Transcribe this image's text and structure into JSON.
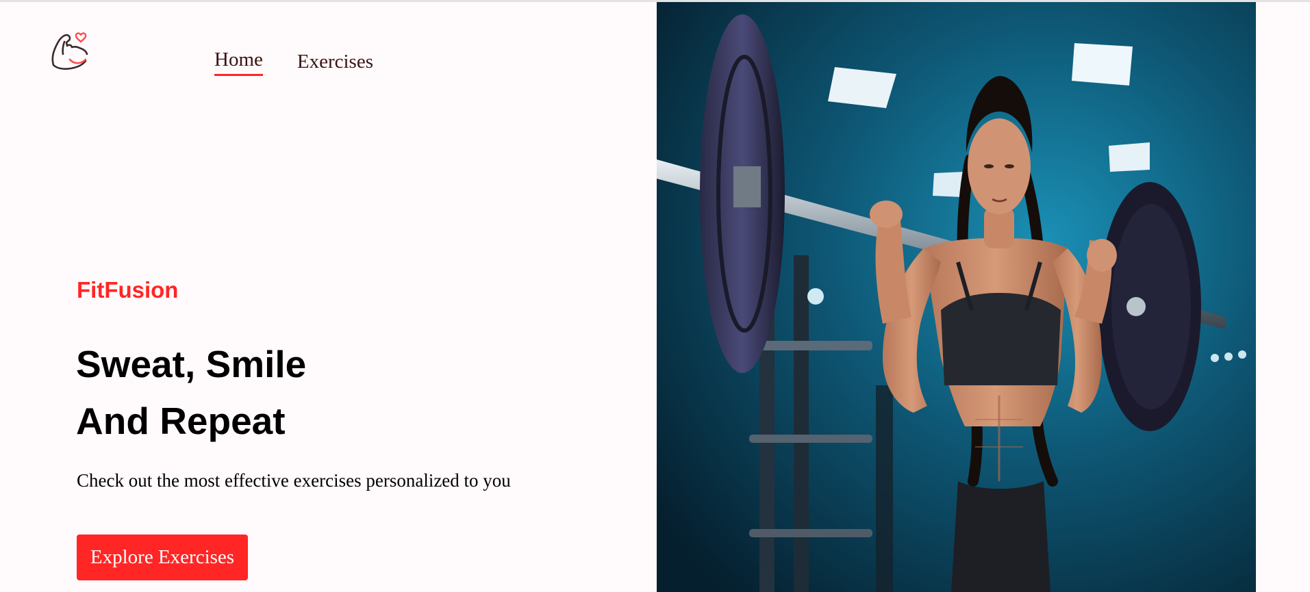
{
  "header": {
    "logo_icon": "flexed-bicep-heart-icon",
    "nav": [
      {
        "label": "Home",
        "active": true
      },
      {
        "label": "Exercises",
        "active": false
      }
    ]
  },
  "hero": {
    "brand": "FitFusion",
    "headline_line1": "Sweat, Smile",
    "headline_line2": "And Repeat",
    "subtitle": "Check out the most effective exercises personalized to you",
    "cta_label": "Explore Exercises",
    "image_icon": "woman-barbell-squat-gym-photo"
  },
  "colors": {
    "accent": "#ff2625",
    "background": "#fffafb",
    "nav_text": "#3a1212",
    "gym_teal": "#0f5f7a"
  }
}
